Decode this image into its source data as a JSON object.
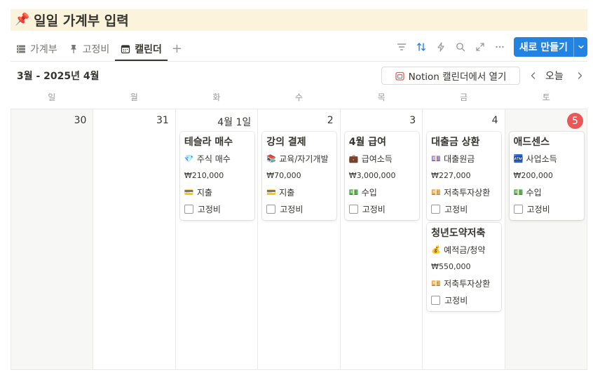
{
  "title": {
    "icon": "📌",
    "text": "일일 가계부 입력"
  },
  "tabs": [
    {
      "label": "가계부",
      "icon": "table-icon"
    },
    {
      "label": "고정비",
      "icon": "pin-icon"
    },
    {
      "label": "캘린더",
      "icon": "calendar-icon",
      "active": true
    }
  ],
  "toolbar": {
    "icons": [
      "filter-icon",
      "sort-icon",
      "lightning-icon",
      "search-icon",
      "expand-icon",
      "more-icon"
    ],
    "new_label": "새로 만들기"
  },
  "calendar": {
    "range": "3월 - 2025년 4월",
    "open_label": "Notion 캘린더에서 열기",
    "today_label": "오늘",
    "weekdays": [
      "일",
      "월",
      "화",
      "수",
      "목",
      "금",
      "토"
    ],
    "days": [
      "30",
      "31",
      "4월 1일",
      "2",
      "3",
      "4",
      "5"
    ]
  },
  "events": {
    "tue": {
      "title": "테슬라 매수",
      "category_icon": "💎",
      "category": "주식 매수",
      "amount": "₩210,000",
      "type_icon": "💳",
      "type": "지출",
      "fixed_label": "고정비"
    },
    "wed": {
      "title": "강의 결제",
      "category_icon": "📚",
      "category": "교육/자기개발",
      "amount": "₩70,000",
      "type_icon": "💳",
      "type": "지출",
      "fixed_label": "고정비"
    },
    "thu": {
      "title": "4월 급여",
      "category_icon": "💼",
      "category": "급여소득",
      "amount": "₩3,000,000",
      "type_icon": "💵",
      "type": "수입",
      "fixed_label": "고정비"
    },
    "fri1": {
      "title": "대출금 상환",
      "category_icon": "💷",
      "category": "대출원금",
      "amount": "₩227,000",
      "type_icon": "💴",
      "type": "저축투자상환",
      "fixed_label": "고정비"
    },
    "fri2": {
      "title": "청년도약저축",
      "category_icon": "💰",
      "category": "예적금/청약",
      "amount": "₩550,000",
      "type_icon": "💴",
      "type": "저축투자상환",
      "fixed_label": "고정비"
    },
    "sat": {
      "title": "애드센스",
      "category_icon": "🏧",
      "category": "사업소득",
      "amount": "₩200,000",
      "type_icon": "💵",
      "type": "수입",
      "fixed_label": "고정비"
    }
  },
  "colors": {
    "accent": "#2383e2",
    "today_badge": "#eb5757",
    "title_bg": "#fbf3db"
  }
}
